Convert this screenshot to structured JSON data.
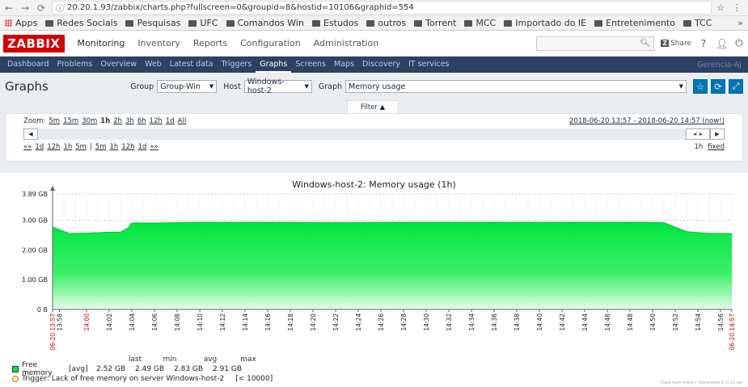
{
  "browser": {
    "url": "20.20.1.93/zabbix/charts.php?fullscreen=0&groupid=8&hostid=10106&graphid=554",
    "bookmarks": [
      "Apps",
      "Redes Sociais",
      "Pesquisas",
      "UFC",
      "Comandos Win",
      "Estudos",
      "outros",
      "Torrent",
      "MCC",
      "Importado do IE",
      "Entretenimento",
      "TCC"
    ]
  },
  "header": {
    "logo": "ZABBIX",
    "menu": [
      "Monitoring",
      "Inventory",
      "Reports",
      "Configuration",
      "Administration"
    ],
    "share": "Share",
    "help": "?",
    "user_icon": "user-icon",
    "power_icon": "power-icon"
  },
  "subnav": {
    "items": [
      "Dashboard",
      "Problems",
      "Overview",
      "Web",
      "Latest data",
      "Triggers",
      "Graphs",
      "Screens",
      "Maps",
      "Discovery",
      "IT services"
    ],
    "active": "Graphs",
    "right": "Gerencia-AJ"
  },
  "page": {
    "title": "Graphs",
    "group_label": "Group",
    "group_value": "Group-Win",
    "host_label": "Host",
    "host_value": "Windows-host-2",
    "graph_label": "Graph",
    "graph_value": "Memory usage",
    "filter_tab": "Filter ▲"
  },
  "timeline": {
    "zoom_label": "Zoom:",
    "zoom": [
      "5m",
      "15m",
      "30m",
      "1h",
      "2h",
      "3h",
      "6h",
      "12h",
      "1d",
      "All"
    ],
    "zoom_active": "1h",
    "daterange": "2018-06-20 13:57 - 2018-06-20 14:57 (now!)",
    "back": [
      "««",
      "1d",
      "12h",
      "1h",
      "5m"
    ],
    "fwd": [
      "5m",
      "1h",
      "12h",
      "1d",
      "»»"
    ],
    "period": "1h",
    "fixed": "fixed"
  },
  "chart_data": {
    "type": "area",
    "title": "Windows-host-2: Memory usage (1h)",
    "y_unit": "GB",
    "ylim": [
      0,
      3.89
    ],
    "yticks": [
      "0 B",
      "1.00 GB",
      "2.00 GB",
      "3.00 GB",
      "3.89 GB"
    ],
    "xticks": [
      "06-20 13:57",
      "13:58",
      "14:00",
      "14:02",
      "14:04",
      "14:06",
      "14:08",
      "14:10",
      "14:12",
      "14:14",
      "14:16",
      "14:18",
      "14:20",
      "14:22",
      "14:24",
      "14:26",
      "14:28",
      "14:30",
      "14:32",
      "14:34",
      "14:36",
      "14:38",
      "14:40",
      "14:42",
      "14:44",
      "14:46",
      "14:48",
      "14:50",
      "14:52",
      "14:54",
      "14:56",
      "06-20 14:57"
    ],
    "series": [
      {
        "name": "Free memory",
        "color": "#00e53f",
        "x_minutes": [
          0,
          0.5,
          1.5,
          3,
          5,
          6,
          6.7,
          7,
          9,
          13,
          20,
          26,
          30,
          35,
          40,
          46,
          50,
          52,
          54,
          56,
          58,
          60
        ],
        "values": [
          2.78,
          2.7,
          2.55,
          2.57,
          2.6,
          2.6,
          2.75,
          2.91,
          2.91,
          2.93,
          2.93,
          2.92,
          2.93,
          2.93,
          2.93,
          2.93,
          2.93,
          2.93,
          2.92,
          2.62,
          2.56,
          2.55
        ]
      }
    ],
    "trigger_value": 10000
  },
  "legend": {
    "headers": [
      "last",
      "min",
      "avg",
      "max"
    ],
    "row1_name": "Free memory",
    "row1_fn": "[avg]",
    "row1_vals": [
      "2.52 GB",
      "2.49 GB",
      "2.83 GB",
      "2.91 GB"
    ],
    "row2_text": "Trigger: Lack of free memory on server Windows-host-2",
    "row2_val": "[< 10000]"
  },
  "footer_note": "Data from history. Generated in 0.12 sec"
}
